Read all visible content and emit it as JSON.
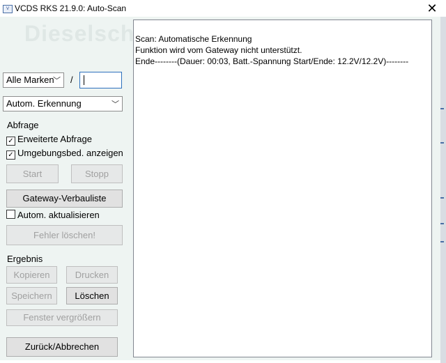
{
  "window": {
    "title": "VCDS RKS 21.9.0:  Auto-Scan",
    "icon": "vcds-app-icon"
  },
  "watermark": "Dieselschrauber",
  "controls": {
    "manufacturer_select": "Alle Marken",
    "separator": "/",
    "address_input": "",
    "mode_select": "Autom. Erkennung",
    "query_group": "Abfrage",
    "extended_query": {
      "label": "Erweiterte Abfrage",
      "checked": true
    },
    "show_environment": {
      "label": "Umgebungsbed. anzeigen",
      "checked": true
    },
    "start": "Start",
    "stop": "Stopp",
    "gateway_list": "Gateway-Verbauliste",
    "auto_update": {
      "label": "Autom. aktualisieren",
      "checked": false
    },
    "clear_faults": "Fehler löschen!",
    "result_group": "Ergebnis",
    "copy": "Kopieren",
    "print": "Drucken",
    "save": "Speichern",
    "delete": "Löschen",
    "enlarge": "Fenster vergrößern",
    "back": "Zurück/Abbrechen"
  },
  "output": {
    "lines": [
      "Scan: Automatische Erkennung",
      "Funktion wird vom Gateway nicht unterstützt.",
      "Ende--------(Dauer: 00:03, Batt.-Spannung Start/Ende: 12.2V/12.2V)--------"
    ]
  },
  "colors": {
    "client_bg": "#eef4f2",
    "disabled_text": "#a0a0a0",
    "focus_border": "#2c6fbd"
  }
}
